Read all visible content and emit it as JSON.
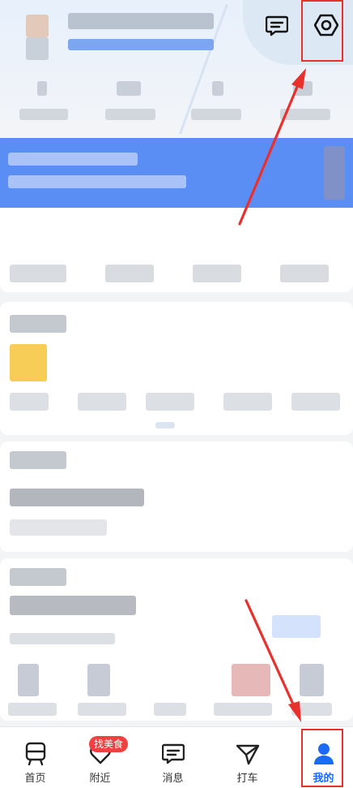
{
  "tabbar": {
    "tabs": [
      {
        "label": "首页",
        "icon": "home-icon"
      },
      {
        "label": "附近",
        "icon": "nearby-heart-icon"
      },
      {
        "label": "消息",
        "icon": "message-icon"
      },
      {
        "label": "打车",
        "icon": "taxi-icon"
      },
      {
        "label": "我的",
        "icon": "profile-icon",
        "active": true
      }
    ],
    "nearby_badge": "找美食"
  },
  "header": {
    "message_icon": "message-icon",
    "settings_icon": "settings-hexagon-icon"
  },
  "colors": {
    "accent": "#1a6af5",
    "banner": "#5b8ef5",
    "annotation": "#e8302c",
    "badge": "#f04141"
  }
}
